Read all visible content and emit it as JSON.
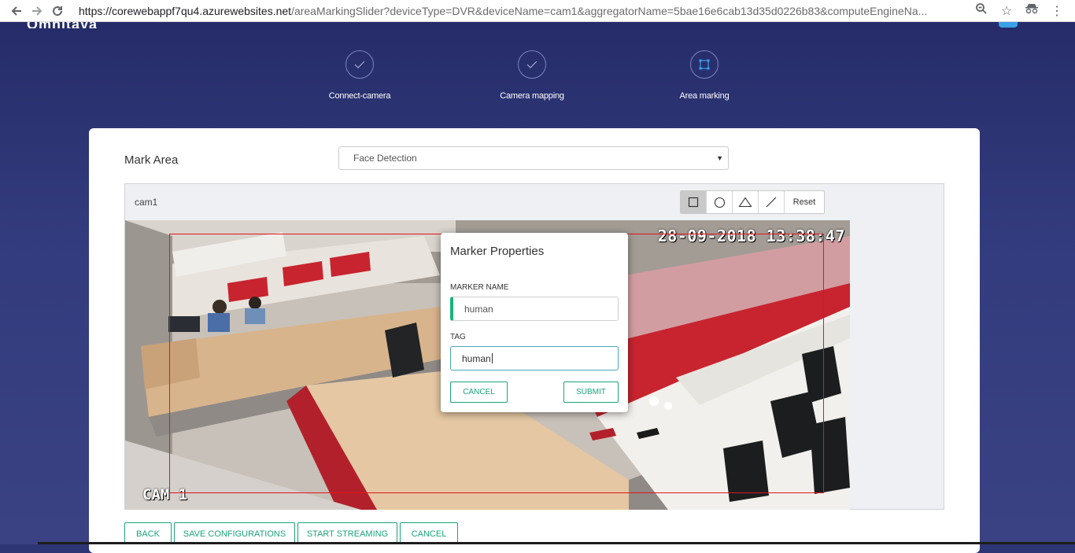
{
  "browser": {
    "url_host": "https://corewebappf7qu4.azurewebsites.net",
    "url_rest": "/areaMarkingSlider?deviceType=DVR&deviceName=cam1&aggregatorName=5bae16e6cab13d35d0226b83&computeEngineNa..."
  },
  "steps": [
    {
      "label": "Connect-camera",
      "state": "done"
    },
    {
      "label": "Camera mapping",
      "state": "done"
    },
    {
      "label": "Area marking",
      "state": "current"
    }
  ],
  "mark_area": {
    "label": "Mark Area",
    "selected": "Face Detection"
  },
  "camera": {
    "name": "cam1",
    "osd_timestamp": "28-09-2018 13:38:47",
    "osd_label": "CAM 1"
  },
  "toolbar": {
    "reset_label": "Reset"
  },
  "modal": {
    "title": "Marker Properties",
    "marker_name_label": "MARKER NAME",
    "marker_name_value": "human",
    "tag_label": "TAG",
    "tag_value": "human",
    "cancel_label": "CANCEL",
    "submit_label": "SUBMIT"
  },
  "footer": {
    "back": "BACK",
    "save": "SAVE CONFIGURATIONS",
    "stream": "START STREAMING",
    "cancel": "CANCEL"
  },
  "colors": {
    "accent": "#1ba37a",
    "header_bg": "#2e3575",
    "marker": "#e3141b"
  }
}
